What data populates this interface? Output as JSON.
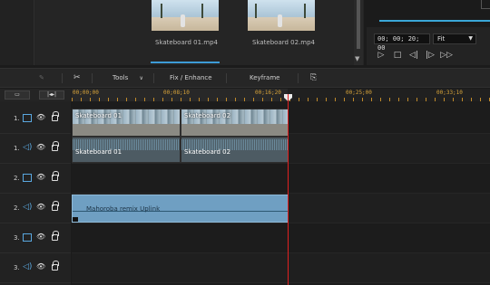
{
  "media": {
    "items": [
      {
        "label": "Skateboard 01.mp4"
      },
      {
        "label": "Skateboard 02.mp4"
      }
    ]
  },
  "preview": {
    "timecode": "00; 00; 20; 00",
    "fit": "Fit"
  },
  "toolbar": {
    "tools_label": "Tools",
    "fix_label": "Fix / Enhance",
    "keyframe_label": "Keyframe"
  },
  "ruler": {
    "ticks": [
      "00;00;00",
      "00;08;10",
      "00;16;20",
      "00;25;00",
      "00;33;10"
    ]
  },
  "tracks": [
    {
      "num": "1.",
      "type": "video"
    },
    {
      "num": "1.",
      "type": "audio"
    },
    {
      "num": "2.",
      "type": "video"
    },
    {
      "num": "2.",
      "type": "audio"
    },
    {
      "num": "3.",
      "type": "video"
    },
    {
      "num": "3.",
      "type": "audio"
    }
  ],
  "clips": {
    "video": [
      "Skateboard 01",
      "Skateboard 02"
    ],
    "audio": [
      "Skateboard 01",
      "Skateboard 02"
    ],
    "music": "Mahoroba remix Uplink"
  },
  "colors": {
    "accent": "#3d9bd6",
    "playhead": "#e02020",
    "ruler_text": "#d9a43a",
    "music_clip": "#6f9fc2"
  }
}
